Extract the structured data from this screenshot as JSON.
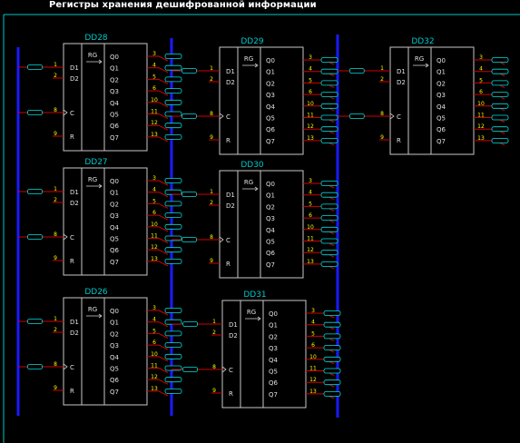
{
  "title": "Регистры хранения дешифрованной информации",
  "colors": {
    "background": "#000000",
    "frame": "#00c8c8",
    "bus": "#1a1aff",
    "chip_border": "#c8c8c8",
    "chip_text": "#e0e0e0",
    "chip_name": "#00c8c8",
    "wire": "#d00000",
    "pin_number": "#ffff00",
    "net_label": "#00e0e0"
  },
  "chip_common": {
    "type_label": "RG",
    "inputs": [
      "D1",
      "D2",
      "C",
      "R"
    ],
    "outputs": [
      "Q0",
      "Q1",
      "Q2",
      "Q3",
      "Q4",
      "Q5",
      "Q6",
      "Q7"
    ],
    "input_pins": [
      "1",
      "2",
      "8",
      "9"
    ],
    "output_pins": [
      "3",
      "4",
      "5",
      "6",
      "10",
      "11",
      "12",
      "13"
    ]
  },
  "chips": [
    {
      "name": "DD28"
    },
    {
      "name": "DD27"
    },
    {
      "name": "DD26"
    },
    {
      "name": "DD29"
    },
    {
      "name": "DD30"
    },
    {
      "name": "DD31"
    },
    {
      "name": "DD32"
    }
  ]
}
